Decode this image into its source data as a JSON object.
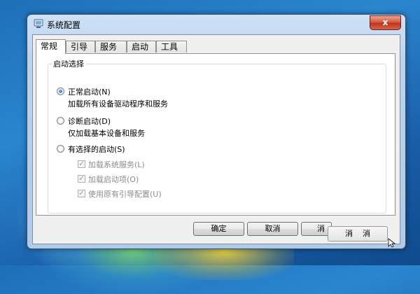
{
  "window": {
    "title": "系统配置",
    "close_glyph": "x"
  },
  "tabs": [
    {
      "label": "常规",
      "active": true
    },
    {
      "label": "引导",
      "active": false
    },
    {
      "label": "服务",
      "active": false
    },
    {
      "label": "启动",
      "active": false
    },
    {
      "label": "工具",
      "active": false
    }
  ],
  "startup": {
    "group_label": "启动选择",
    "normal": {
      "label": "正常启动(N)",
      "desc": "加载所有设备驱动程序和服务",
      "selected": true
    },
    "diagnostic": {
      "label": "诊断启动(D)",
      "desc": "仅加载基本设备和服务",
      "selected": false
    },
    "selective": {
      "label": "有选择的启动(S)",
      "selected": false,
      "options": [
        {
          "label": "加载系统服务(L)",
          "checked": true,
          "enabled": false
        },
        {
          "label": "加载启动项(O)",
          "checked": true,
          "enabled": false
        },
        {
          "label": "使用原有引导配置(U)",
          "checked": true,
          "enabled": false
        }
      ]
    }
  },
  "buttons": {
    "ok": "确定",
    "cancel": "取消",
    "apply": "消",
    "help_overlay": "消    消"
  },
  "colors": {
    "accent": "#1a5fb4",
    "close_red": "#c0321a",
    "desktop": "#1e6fb8"
  }
}
